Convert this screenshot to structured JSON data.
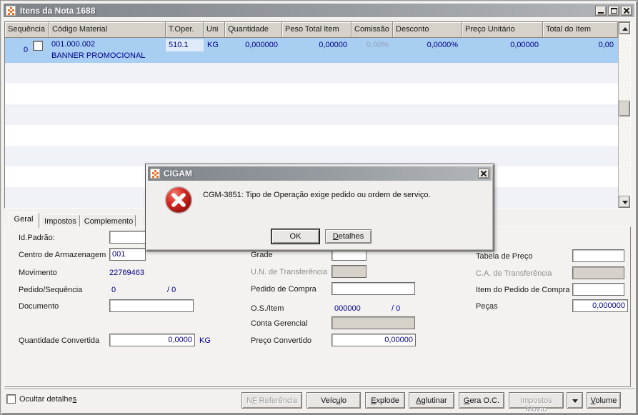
{
  "window": {
    "title": "Itens da Nota 1688"
  },
  "grid": {
    "columns": [
      "Sequência",
      "Código Material",
      "T.Oper.",
      "Uni",
      "Quantidade",
      "Peso Total Item",
      "Comissão",
      "Desconto",
      "Preço Unitário",
      "Total do Item"
    ],
    "row": {
      "sequencia": "0",
      "codigo_material": "001.000.002",
      "descricao": "BANNER PROMOCIONAL",
      "t_oper": "510.1",
      "uni": "KG",
      "quantidade": "0,000000",
      "peso_total_item": "0,00000",
      "comissao": "0,00%",
      "desconto": "0,0000%",
      "preco_unitario": "0,00000",
      "total_do_item": "0,00"
    }
  },
  "dialog": {
    "title": "CIGAM",
    "message": "CGM-3851: Tipo de Operação exige pedido ou ordem de serviço.",
    "ok_label": "OK",
    "detalhes": {
      "pre": "",
      "key": "D",
      "post": "etalhes"
    }
  },
  "tabs": {
    "geral": "Geral",
    "impostos": "Impostos",
    "complemento": "Complemento"
  },
  "form": {
    "id_padrao": {
      "label": "Id.Padrão:",
      "value": ""
    },
    "centro_armazenagem": {
      "label": "Centro de Armazenagem",
      "value": "001"
    },
    "movimento": {
      "label": "Movimento",
      "value": "22769463"
    },
    "pedido_sequencia": {
      "label": "Pedido/Sequência",
      "value": "0",
      "value2": "/ 0"
    },
    "documento": {
      "label": "Documento",
      "value": ""
    },
    "quantidade_convertida": {
      "label": "Quantidade Convertida",
      "value": "0,0000",
      "suffix": "KG"
    },
    "grade": {
      "label": "Grade",
      "value": ""
    },
    "un_transferencia": {
      "label": "U.N. de Transferência",
      "value": ""
    },
    "pedido_compra": {
      "label": "Pedido de Compra",
      "value": ""
    },
    "os_item": {
      "label": "O.S./Item",
      "value": "000000",
      "value2": "/ 0"
    },
    "conta_gerencial": {
      "label": "Conta Gerencial",
      "value": ""
    },
    "preco_convertido": {
      "label": "Preço Convertido",
      "value": "0,00000"
    },
    "tabela_preco": {
      "label": "Tabela de Preço",
      "value": ""
    },
    "ca_transferencia": {
      "label": "C.A. de Transferência",
      "value": ""
    },
    "item_pedido_compra": {
      "label": "Item do Pedido de Compra",
      "value": ""
    },
    "pecas": {
      "label": "Peças",
      "value": "0,000000"
    }
  },
  "footer": {
    "ocultar_detalhes": {
      "pre": "Ocultar detalhe",
      "key": "s",
      "post": ""
    },
    "nf_referencia": {
      "pre": "N",
      "key": "F",
      "post": " Referência"
    },
    "veiculo": {
      "pre": "Veíc",
      "key": "u",
      "post": "lo"
    },
    "explode": {
      "pre": "",
      "key": "E",
      "post": "xplode"
    },
    "aglutinar": {
      "pre": "",
      "key": "A",
      "post": "glutinar"
    },
    "gera_oc": {
      "pre": "",
      "key": "G",
      "post": "era O.C."
    },
    "impostos_movto": {
      "pre": "Impostos Movto",
      "key": "",
      "post": ""
    },
    "volume": {
      "pre": "",
      "key": "V",
      "post": "olume"
    }
  },
  "colors": {
    "selected_row": "#A8CEF2",
    "value_navy": "#000089",
    "error_red": "#C41A1A",
    "titlebar_gray": "#8A8F95"
  }
}
